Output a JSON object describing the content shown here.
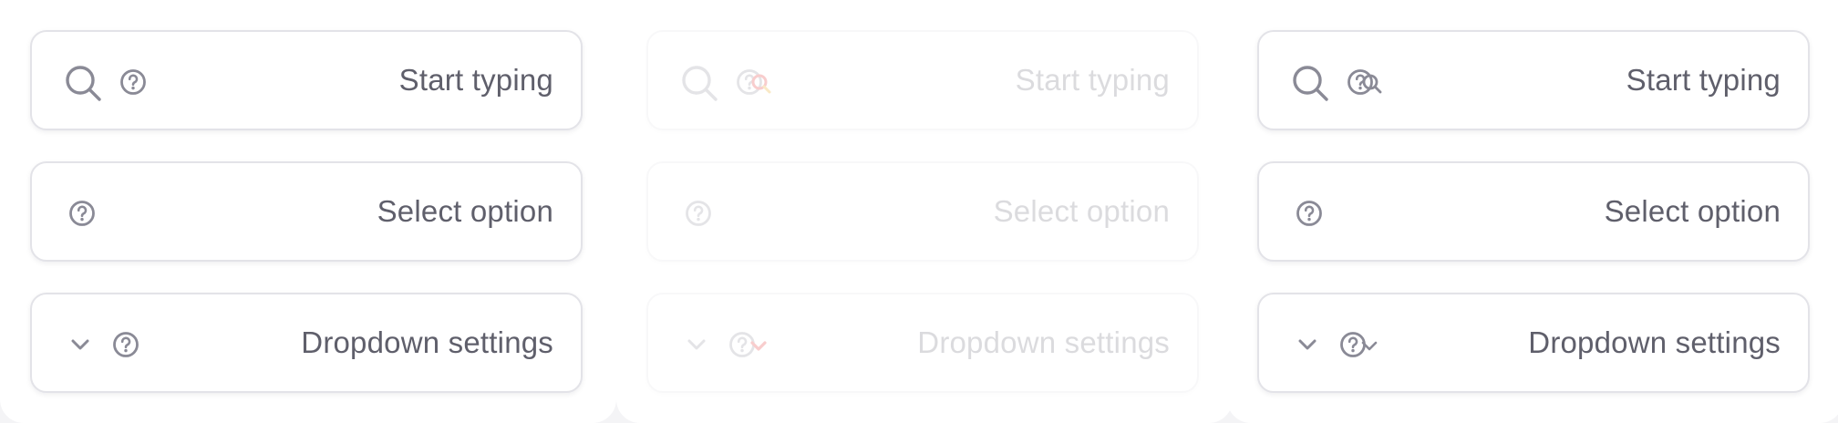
{
  "panels": [
    {
      "state": "default",
      "fields": {
        "search": {
          "value": "Start typing",
          "icons": [
            "search-icon",
            "help-icon"
          ]
        },
        "select": {
          "value": "Select option",
          "icons": [
            "help-icon"
          ]
        },
        "dropdown": {
          "value": "Dropdown settings",
          "icons": [
            "chevron-down-icon",
            "help-icon"
          ]
        }
      }
    },
    {
      "state": "disabled",
      "fields": {
        "search": {
          "value": "Start typing",
          "icons": [
            "search-icon",
            "help-icon"
          ]
        },
        "select": {
          "value": "Select option",
          "icons": [
            "help-icon"
          ]
        },
        "dropdown": {
          "value": "Dropdown settings",
          "icons": [
            "chevron-down-icon",
            "help-icon"
          ]
        }
      }
    },
    {
      "state": "hover",
      "fields": {
        "search": {
          "value": "Start typing",
          "icons": [
            "search-icon",
            "help-icon"
          ]
        },
        "select": {
          "value": "Select option",
          "icons": [
            "help-icon"
          ]
        },
        "dropdown": {
          "value": "Dropdown settings",
          "icons": [
            "chevron-down-icon",
            "help-icon"
          ]
        }
      }
    }
  ],
  "colors": {
    "text": "#5f5f6b",
    "icon": "#8a8a96",
    "border": "#e3e3e8",
    "cursor_highlight": "#e02020",
    "background": "#f4f4f6"
  }
}
